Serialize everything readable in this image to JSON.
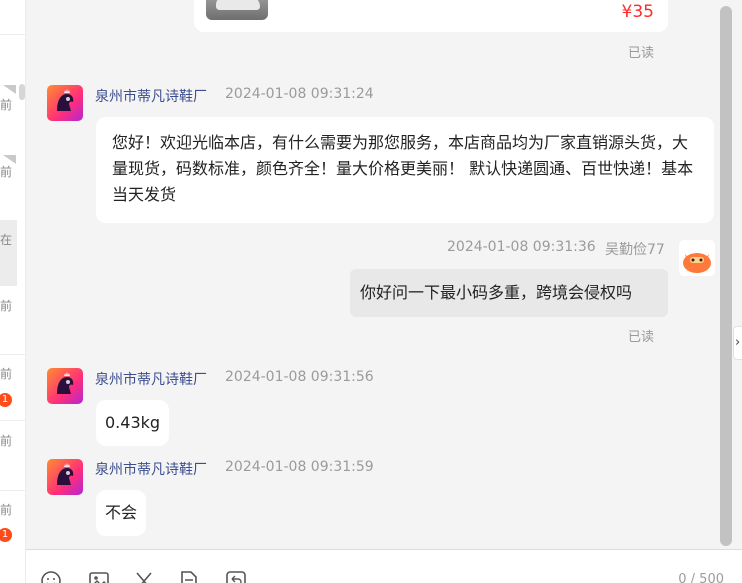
{
  "conversation_list": {
    "items": [
      {
        "time_text": "前",
        "badge": ""
      },
      {
        "time_text": "前",
        "badge": ""
      },
      {
        "time_text": "在",
        "badge": ""
      },
      {
        "time_text": "前",
        "badge": ""
      },
      {
        "time_text": "前",
        "badge": "1"
      },
      {
        "time_text": "前",
        "badge": ""
      },
      {
        "time_text": "前",
        "badge": "1"
      }
    ]
  },
  "product_card": {
    "price": "¥35",
    "read_status": "已读"
  },
  "messages": [
    {
      "sender": "泉州市蒂凡诗鞋厂",
      "timestamp": "2024-01-08 09:31:24",
      "text": "您好！欢迎光临本店，有什么需要为那您服务，本店商品均为厂家直销源头货，大量现货，码数标准，颜色齐全！量大价格更美丽！ 默认快递圆通、百世快递！基本当天发货"
    },
    {
      "sender": "吴勤俭77",
      "timestamp": "2024-01-08 09:31:36",
      "text": "你好问一下最小码多重，跨境会侵权吗",
      "read_status": "已读"
    },
    {
      "sender": "泉州市蒂凡诗鞋厂",
      "timestamp": "2024-01-08 09:31:56",
      "text": "0.43kg"
    },
    {
      "sender": "泉州市蒂凡诗鞋厂",
      "timestamp": "2024-01-08 09:31:59",
      "text": "不会"
    }
  ],
  "side_toggle": "›",
  "input_bar": {
    "tools": [
      "emoji-icon",
      "image-icon",
      "scissors-icon",
      "document-icon",
      "history-icon"
    ],
    "char_counter": "0 / 500"
  },
  "colors": {
    "price": "#ff2a2a",
    "sender_name": "#3d4e8f",
    "my_bubble": "#e8e8e8",
    "badge": "#ff4a1a"
  }
}
